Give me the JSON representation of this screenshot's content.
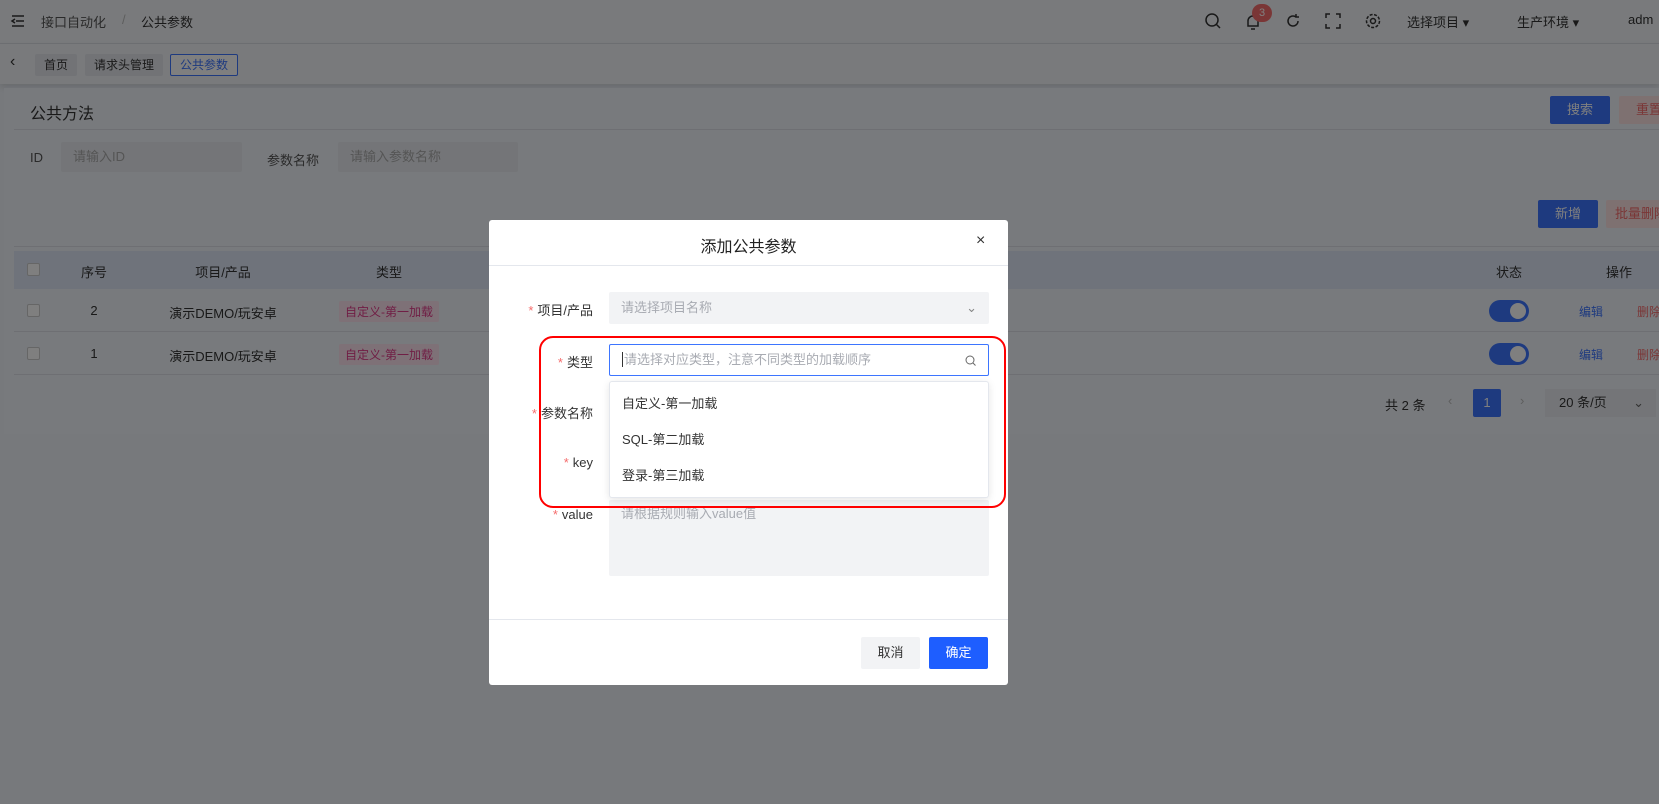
{
  "header": {
    "breadcrumb": [
      "接口自动化",
      "公共参数"
    ],
    "separator": "/",
    "notification_count": "3",
    "project_select": "选择项目",
    "env_select": "生产环境",
    "user": "adm"
  },
  "tags": [
    "首页",
    "请求头管理",
    "公共参数"
  ],
  "page": {
    "title": "公共方法",
    "search_label": "搜索",
    "reset_label": "重置",
    "add_label": "新增",
    "batch_delete_label": "批量删除",
    "filters": [
      {
        "label": "ID",
        "placeholder": "请输入ID"
      },
      {
        "label": "参数名称",
        "placeholder": "请输入参数名称"
      }
    ]
  },
  "table": {
    "headers": [
      "序号",
      "项目/产品",
      "类型",
      "状态",
      "操作"
    ],
    "rows": [
      {
        "index": "2",
        "project": "演示DEMO/玩安卓",
        "type": "自定义-第一加载",
        "enabled": true,
        "edit": "编辑",
        "delete": "删除"
      },
      {
        "index": "1",
        "project": "演示DEMO/玩安卓",
        "type": "自定义-第一加载",
        "enabled": true,
        "edit": "编辑",
        "delete": "删除"
      }
    ]
  },
  "pagination": {
    "total": "共 2 条",
    "current": "1",
    "page_size": "20 条/页"
  },
  "dialog": {
    "title": "添加公共参数",
    "fields": {
      "project": {
        "label": "项目/产品",
        "placeholder": "请选择项目名称"
      },
      "type": {
        "label": "类型",
        "placeholder": "请选择对应类型，注意不同类型的加载顺序"
      },
      "name": {
        "label": "参数名称"
      },
      "key": {
        "label": "key"
      },
      "value": {
        "label": "value",
        "placeholder": "请根据规则输入value值"
      }
    },
    "type_options": [
      "自定义-第一加载",
      "SQL-第二加载",
      "登录-第三加载"
    ],
    "cancel": "取消",
    "confirm": "确定"
  },
  "colors": {
    "primary": "#3d75ff",
    "danger": "#f56c6c",
    "highlight": "#ff0000"
  }
}
